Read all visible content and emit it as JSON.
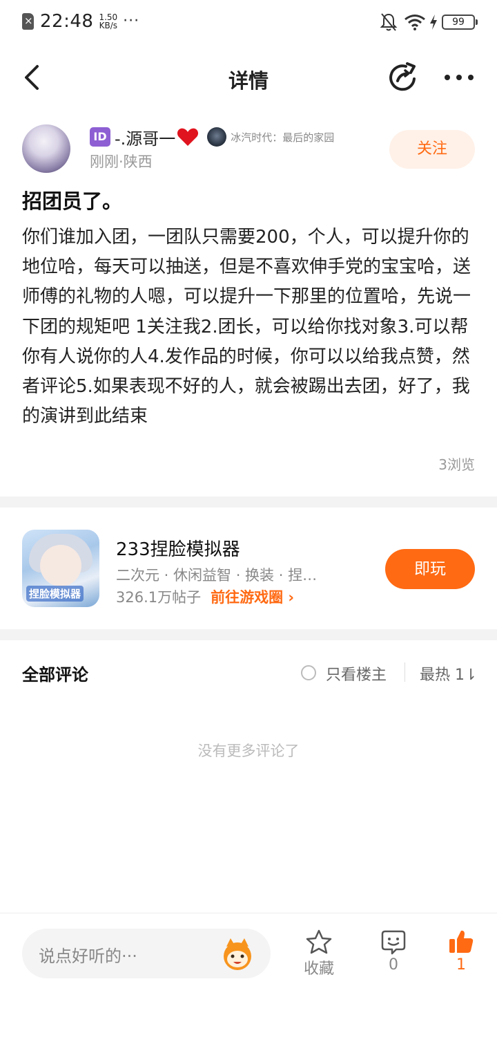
{
  "status_bar": {
    "time": "22:48",
    "speed_value": "1.50",
    "speed_unit": "KB/s",
    "more": "···",
    "battery": "99"
  },
  "nav": {
    "title": "详情"
  },
  "author": {
    "id_badge": "ID",
    "name": "-.源哥一",
    "heart": "❤",
    "game_name": "冰汽时代：最后的家园",
    "meta": "刚刚·陕西",
    "follow_label": "关注"
  },
  "post": {
    "title": "招团员了。",
    "body": "你们谁加入团，一团队只需要200，个人，可以提升你的地位哈，每天可以抽送，但是不喜欢伸手党的宝宝哈，送师傅的礼物的人嗯，可以提升一下那里的位置哈，先说一下团的规矩吧 1关注我2.团长，可以给你找对象3.可以帮你有人说你的人4.发作品的时候，你可以以给我点赞，然者评论5.如果表现不好的人，就会被踢出去团，好了，我的演讲到此结束",
    "views": "3浏览"
  },
  "game_card": {
    "name": "233捏脸模拟器",
    "tags": "二次元 · 休闲益智 · 换装 · 捏…",
    "posts": "326.1万帖子",
    "link": "前往游戏圈 ›",
    "icon_text": "捏脸模拟器",
    "play_label": "即玩"
  },
  "comments": {
    "title": "全部评论",
    "only_owner": "只看楼主",
    "sort": "最热 1⇂",
    "empty": "没有更多评论了"
  },
  "bottom_bar": {
    "placeholder": "说点好听的···",
    "favorite_label": "收藏",
    "comment_count": "0",
    "like_count": "1"
  },
  "colors": {
    "accent": "#ff6a13",
    "follow_bg": "#fff1e8",
    "separator": "#f3f3f3"
  }
}
